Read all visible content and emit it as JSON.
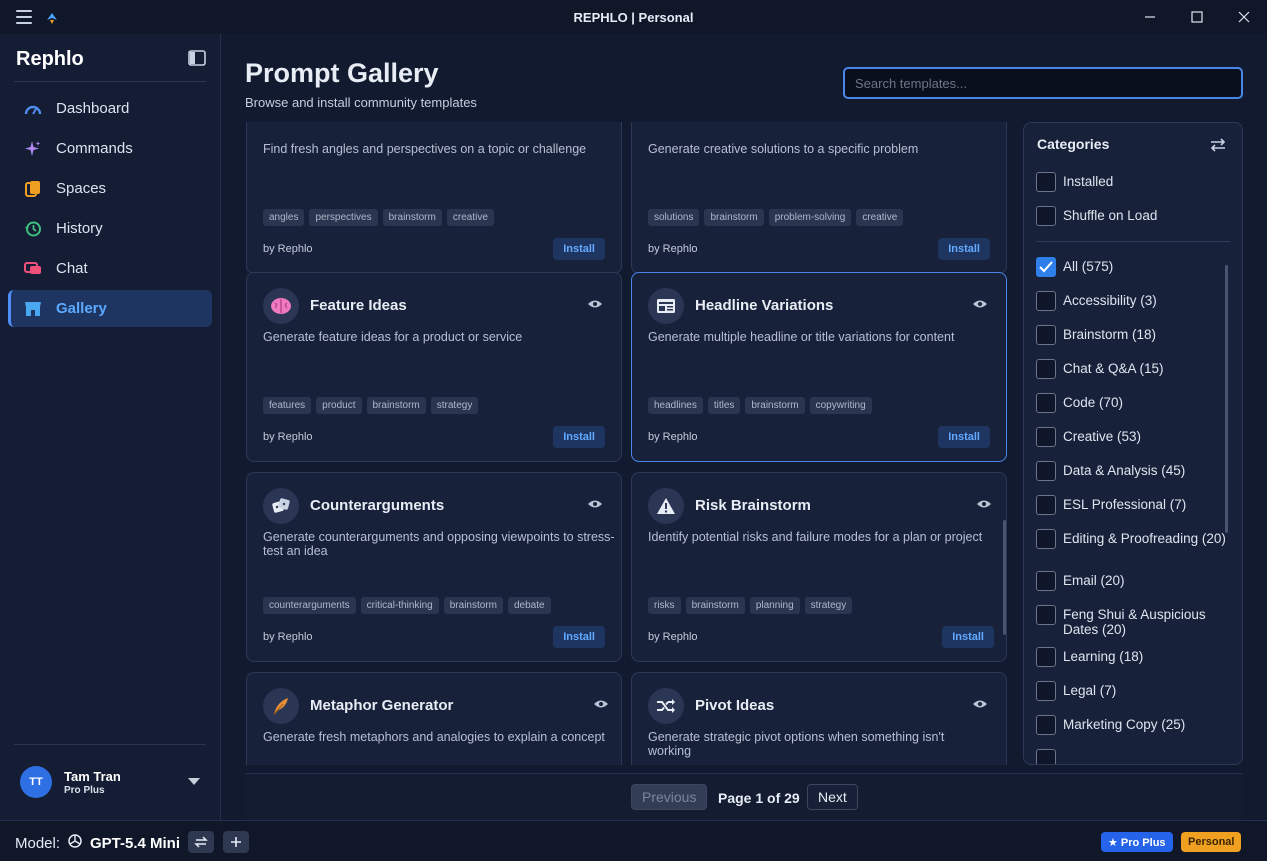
{
  "window": {
    "title": "REPHLO | Personal"
  },
  "sidebar": {
    "brand": "Rephlo",
    "items": [
      {
        "label": "Dashboard",
        "icon": "gauge-icon",
        "active": false
      },
      {
        "label": "Commands",
        "icon": "sparkle-icon",
        "active": false
      },
      {
        "label": "Spaces",
        "icon": "folders-icon",
        "active": false
      },
      {
        "label": "History",
        "icon": "history-icon",
        "active": false
      },
      {
        "label": "Chat",
        "icon": "chat-icon",
        "active": false
      },
      {
        "label": "Gallery",
        "icon": "store-icon",
        "active": true
      }
    ],
    "user": {
      "initials": "TT",
      "name": "Tam Tran",
      "plan": "Pro Plus"
    }
  },
  "header": {
    "title": "Prompt Gallery",
    "subtitle": "Browse and install community templates",
    "search_placeholder": "Search templates..."
  },
  "cards": [
    {
      "title": "",
      "desc": "Find fresh angles and perspectives on a topic or challenge",
      "tags": [
        "angles",
        "perspectives",
        "brainstorm",
        "creative"
      ],
      "author": "by Rephlo",
      "install": "Install"
    },
    {
      "title": "",
      "desc": "Generate creative solutions to a specific problem",
      "tags": [
        "solutions",
        "brainstorm",
        "problem-solving",
        "creative"
      ],
      "author": "by Rephlo",
      "install": "Install"
    },
    {
      "title": "Feature Ideas",
      "icon": "brain-icon",
      "desc": "Generate feature ideas for a product or service",
      "tags": [
        "features",
        "product",
        "brainstorm",
        "strategy"
      ],
      "author": "by Rephlo",
      "install": "Install"
    },
    {
      "title": "Headline Variations",
      "icon": "newspaper-icon",
      "desc": "Generate multiple headline or title variations for content",
      "tags": [
        "headlines",
        "titles",
        "brainstorm",
        "copywriting"
      ],
      "author": "by Rephlo",
      "install": "Install"
    },
    {
      "title": "Counterarguments",
      "icon": "dice-icon",
      "desc": "Generate counterarguments and opposing viewpoints to stress-test an idea",
      "tags": [
        "counterarguments",
        "critical-thinking",
        "brainstorm",
        "debate"
      ],
      "author": "by Rephlo",
      "install": "Install"
    },
    {
      "title": "Risk Brainstorm",
      "icon": "warning-icon",
      "desc": "Identify potential risks and failure modes for a plan or project",
      "tags": [
        "risks",
        "brainstorm",
        "planning",
        "strategy"
      ],
      "author": "by Rephlo",
      "install": "Install"
    },
    {
      "title": "Metaphor Generator",
      "icon": "feather-icon",
      "desc": "Generate fresh metaphors and analogies to explain a concept",
      "tags": [],
      "author": "",
      "install": ""
    },
    {
      "title": "Pivot Ideas",
      "icon": "shuffle-icon",
      "desc": "Generate strategic pivot options when something isn't working",
      "tags": [],
      "author": "",
      "install": ""
    }
  ],
  "categories": {
    "title": "Categories",
    "filters": [
      {
        "label": "Installed",
        "checked": false
      },
      {
        "label": "Shuffle on Load",
        "checked": false
      }
    ],
    "list": [
      {
        "label": "All (575)",
        "checked": true
      },
      {
        "label": "Accessibility (3)",
        "checked": false
      },
      {
        "label": "Brainstorm (18)",
        "checked": false
      },
      {
        "label": "Chat & Q&A (15)",
        "checked": false
      },
      {
        "label": "Code (70)",
        "checked": false
      },
      {
        "label": "Creative (53)",
        "checked": false
      },
      {
        "label": "Data & Analysis (45)",
        "checked": false
      },
      {
        "label": "ESL Professional (7)",
        "checked": false
      },
      {
        "label": "Editing & Proofreading (20)",
        "checked": false
      },
      {
        "label": "Email (20)",
        "checked": false
      },
      {
        "label": "Feng Shui & Auspicious Dates (20)",
        "checked": false
      },
      {
        "label": "Learning (18)",
        "checked": false
      },
      {
        "label": "Legal (7)",
        "checked": false
      },
      {
        "label": "Marketing Copy (25)",
        "checked": false
      }
    ]
  },
  "pagination": {
    "previous": "Previous",
    "info": "Page 1 of 29",
    "next": "Next"
  },
  "footer": {
    "model_label": "Model:",
    "model_name": "GPT-5.4 Mini",
    "badge_pro": "★ Pro Plus",
    "badge_personal": "Personal"
  },
  "colors": {
    "accent": "#4a86e8",
    "background": "#111a2e",
    "card": "#17213a",
    "pro_badge": "#2563eb",
    "personal_badge": "#f0a020"
  }
}
